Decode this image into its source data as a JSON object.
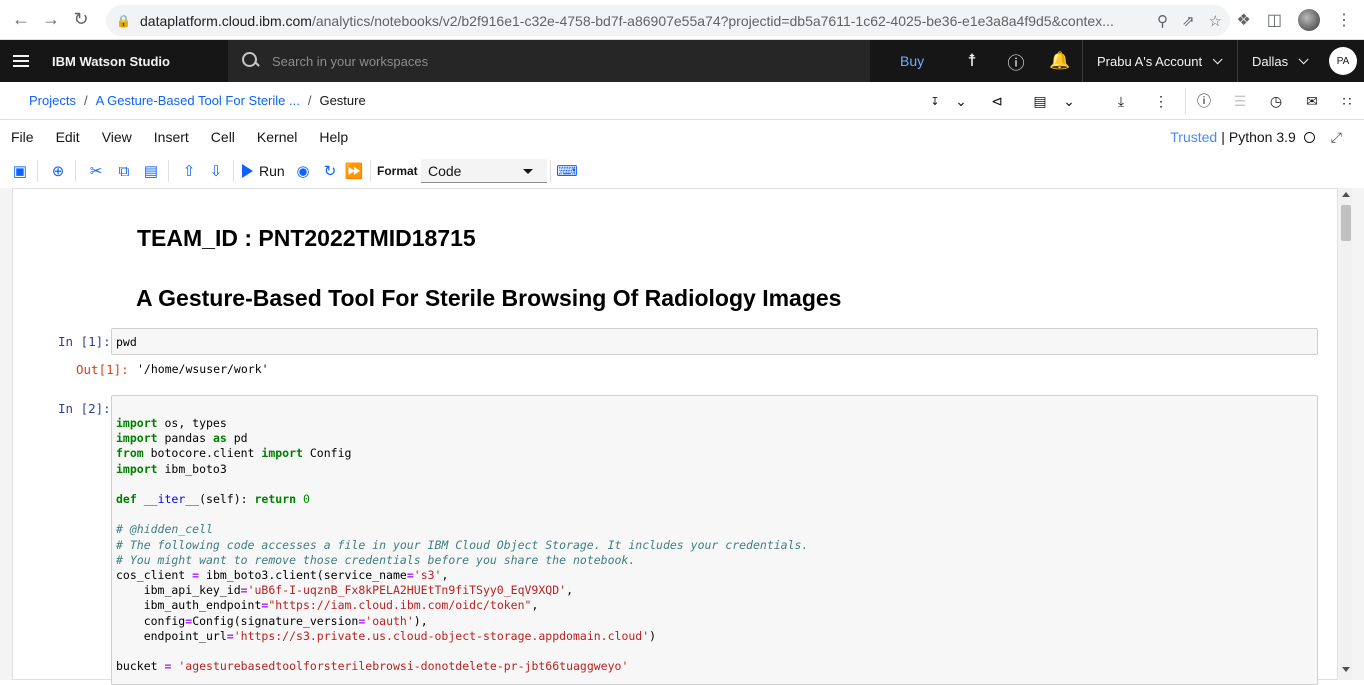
{
  "browser": {
    "url_domain": "dataplatform.cloud.ibm.com",
    "url_path": "/analytics/notebooks/v2/b2f916e1-c32e-4758-bd7f-a86907e55a74?projectid=db5a7611-1c62-4025-be36-e1e3a8a4f9d5&contex..."
  },
  "header": {
    "brand": "IBM Watson Studio",
    "search_placeholder": "Search in your workspaces",
    "buy_label": "Buy",
    "account_label": "Prabu A's Account",
    "region_label": "Dallas",
    "avatar_initials": "PA"
  },
  "breadcrumb": {
    "projects": "Projects",
    "project_name": "A Gesture-Based Tool For Sterile ...",
    "current": "Gesture"
  },
  "menu": {
    "items": [
      "File",
      "Edit",
      "View",
      "Insert",
      "Cell",
      "Kernel",
      "Help"
    ],
    "trusted": "Trusted",
    "kernel_name": "Python 3.9"
  },
  "toolbar": {
    "run_label": "Run",
    "format_label": "Format",
    "cell_type": "Code"
  },
  "notebook": {
    "team_id": "TEAM_ID : PNT2022TMID18715",
    "title": "A Gesture-Based Tool For Sterile Browsing Of Radiology Images",
    "cell1_prompt": "In [1]:",
    "cell1_code": "pwd",
    "out1_prompt": "Out[1]:",
    "out1_text": "'/home/wsuser/work'",
    "cell2_prompt": "In [2]:",
    "cell2_lines": {
      "l1a": "import",
      "l1b": " os, types",
      "l2a": "import",
      "l2b": " pandas ",
      "l2c": "as",
      "l2d": " pd",
      "l3a": "from",
      "l3b": " botocore.client ",
      "l3c": "import",
      "l3d": " Config",
      "l4a": "import",
      "l4b": " ibm_boto3",
      "l5a": "def",
      "l5b": " ",
      "l5c": "__iter__",
      "l5d": "(self): ",
      "l5e": "return",
      "l5f": " ",
      "l5g": "0",
      "c1": "# @hidden_cell",
      "c2": "# The following code accesses a file in your IBM Cloud Object Storage. It includes your credentials.",
      "c3": "# You might want to remove those credentials before you share the notebook.",
      "l6a": "cos_client ",
      "l6b": "=",
      "l6c": " ibm_boto3.client(service_name",
      "l6d": "=",
      "l6e": "'s3'",
      "l6f": ",",
      "l7a": "    ibm_api_key_id",
      "l7b": "=",
      "l7c": "'uB6f-I-uqznB_Fx8kPELA2HUEtTn9fiTSyy0_EqV9XQD'",
      "l7d": ",",
      "l8a": "    ibm_auth_endpoint",
      "l8b": "=",
      "l8c": "\"https://iam.cloud.ibm.com/oidc/token\"",
      "l8d": ",",
      "l9a": "    config",
      "l9b": "=",
      "l9c": "Config(signature_version",
      "l9d": "=",
      "l9e": "'oauth'",
      "l9f": "),",
      "l10a": "    endpoint_url",
      "l10b": "=",
      "l10c": "'https://s3.private.us.cloud-object-storage.appdomain.cloud'",
      "l10d": ")",
      "l11a": "bucket ",
      "l11b": "=",
      "l11c": " ",
      "l11d": "'agesturebasedtoolforsterilebrowsi-donotdelete-pr-jbt66tuaggweyo'"
    }
  },
  "colors": {
    "ibm_header_bg": "#161616",
    "ibm_search_bg": "#262626",
    "link_blue": "#0f62fe",
    "trusted_blue": "#4589ff",
    "prompt_in": "#303f9f",
    "prompt_out": "#d84315"
  }
}
